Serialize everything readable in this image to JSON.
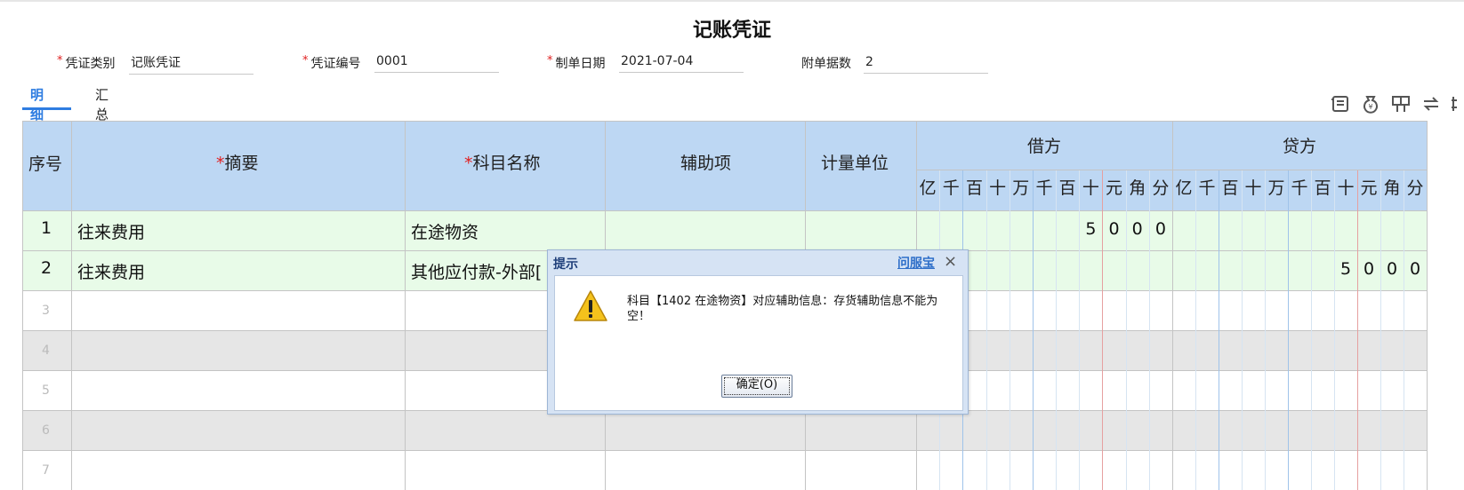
{
  "title": "记账凭证",
  "header": {
    "voucher_type": {
      "label": "凭证类别",
      "value": "记账凭证"
    },
    "voucher_no": {
      "label": "凭证编号",
      "value": "0001"
    },
    "date": {
      "label": "制单日期",
      "value": "2021-07-04"
    },
    "attachments": {
      "label": "附单据数",
      "value": "2"
    }
  },
  "tabs": [
    {
      "label": "明细",
      "active": true
    },
    {
      "label": "汇总",
      "active": false
    }
  ],
  "toolbar": [
    "ledger-icon",
    "money-bag-icon",
    "layout-icon",
    "swap-icon",
    "more-icon"
  ],
  "table": {
    "headers": {
      "seq": "序号",
      "summary": "摘要",
      "account": "科目名称",
      "aux": "辅助项",
      "unit": "计量单位",
      "debit": "借方",
      "credit": "贷方",
      "digits": [
        "亿",
        "千",
        "百",
        "十",
        "万",
        "千",
        "百",
        "十",
        "元",
        "角",
        "分"
      ]
    },
    "rows": [
      {
        "no": "1",
        "summary": "往来费用",
        "account": "在途物资",
        "debit_digits": [
          "",
          "",
          "",
          "",
          "",
          "",
          "",
          "5",
          "0",
          "0",
          "0"
        ],
        "credit_digits": [
          "",
          "",
          "",
          "",
          "",
          "",
          "",
          "",
          "",
          "",
          ""
        ]
      },
      {
        "no": "2",
        "summary": "往来费用",
        "account": "其他应付款-外部[",
        "debit_digits": [
          "",
          "",
          "",
          "",
          "",
          "",
          "",
          "",
          "",
          "",
          ""
        ],
        "credit_digits": [
          "",
          "",
          "",
          "",
          "",
          "",
          "",
          "5",
          "0",
          "0",
          "0"
        ]
      },
      {
        "no": "3",
        "summary": "",
        "account": ""
      },
      {
        "no": "4",
        "summary": "",
        "account": ""
      },
      {
        "no": "5",
        "summary": "",
        "account": ""
      },
      {
        "no": "6",
        "summary": "",
        "account": ""
      },
      {
        "no": "7",
        "summary": "",
        "account": ""
      }
    ]
  },
  "colors": {
    "header_bg": "#bdd7f3",
    "filled_row_bg": "#e8fbe8",
    "empty_row_bg": "#ffffff",
    "alt_row_bg": "#e6e6e6",
    "accent": "#2f7de1",
    "required": "#e02020"
  },
  "dialog": {
    "title": "提示",
    "help_link": "问服宝",
    "close_glyph": "×",
    "message": "科目【1402 在途物资】对应辅助信息：存货辅助信息不能为空！",
    "ok_button": "确定(O)",
    "icon": "warning-icon"
  }
}
